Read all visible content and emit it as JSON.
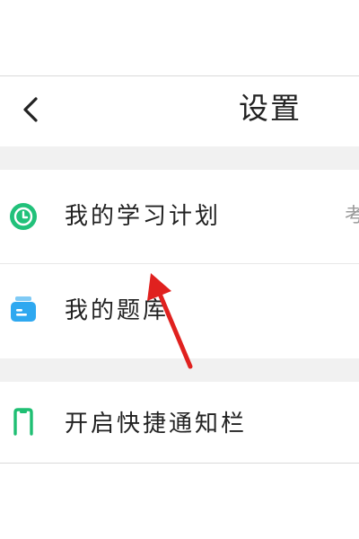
{
  "header": {
    "title": "设置",
    "back_icon": "chevron-left-icon"
  },
  "settings": {
    "items": [
      {
        "label": "我的学习计划",
        "value": "考",
        "icon": "clock-icon",
        "icon_color": "#21c17a"
      },
      {
        "label": "我的题库",
        "icon": "question-bank-icon",
        "icon_color": "#2ea8f0"
      },
      {
        "label": "开启快捷通知栏",
        "icon": "phone-icon",
        "icon_color": "#1fbf73"
      }
    ]
  },
  "annotation": {
    "arrow_color": "#e0211f"
  },
  "colors": {
    "section_gap": "#f1f1f1",
    "text_primary": "#222222",
    "text_secondary": "#9a9a9a"
  }
}
